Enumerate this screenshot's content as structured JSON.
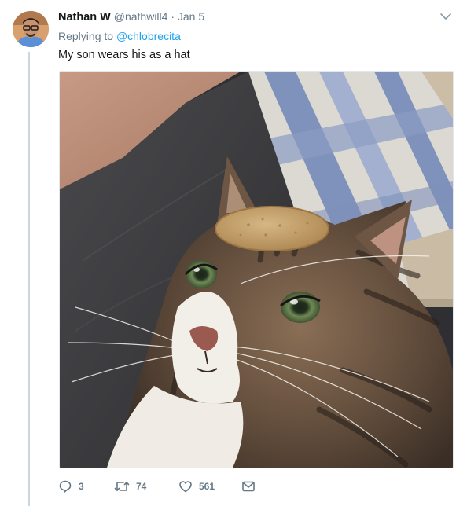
{
  "tweet": {
    "display_name": "Nathan W",
    "handle": "@nathwill4",
    "separator": "·",
    "date": "Jan 5",
    "replying_prefix": "Replying to",
    "replying_handle": "@chlobrecita",
    "text": "My son wears his as a hat",
    "media_description": "photo of a tabby cat with a cracker balanced on its head"
  },
  "actions": {
    "replies": "3",
    "retweets": "74",
    "likes": "561"
  },
  "icons": {
    "caret": "chevron-down-icon",
    "reply": "reply-icon",
    "retweet": "retweet-icon",
    "like": "heart-icon",
    "message": "envelope-icon"
  },
  "colors": {
    "link": "#1da1f2",
    "muted": "#657786",
    "text": "#14171a",
    "thread_line": "#ccd6dd"
  }
}
